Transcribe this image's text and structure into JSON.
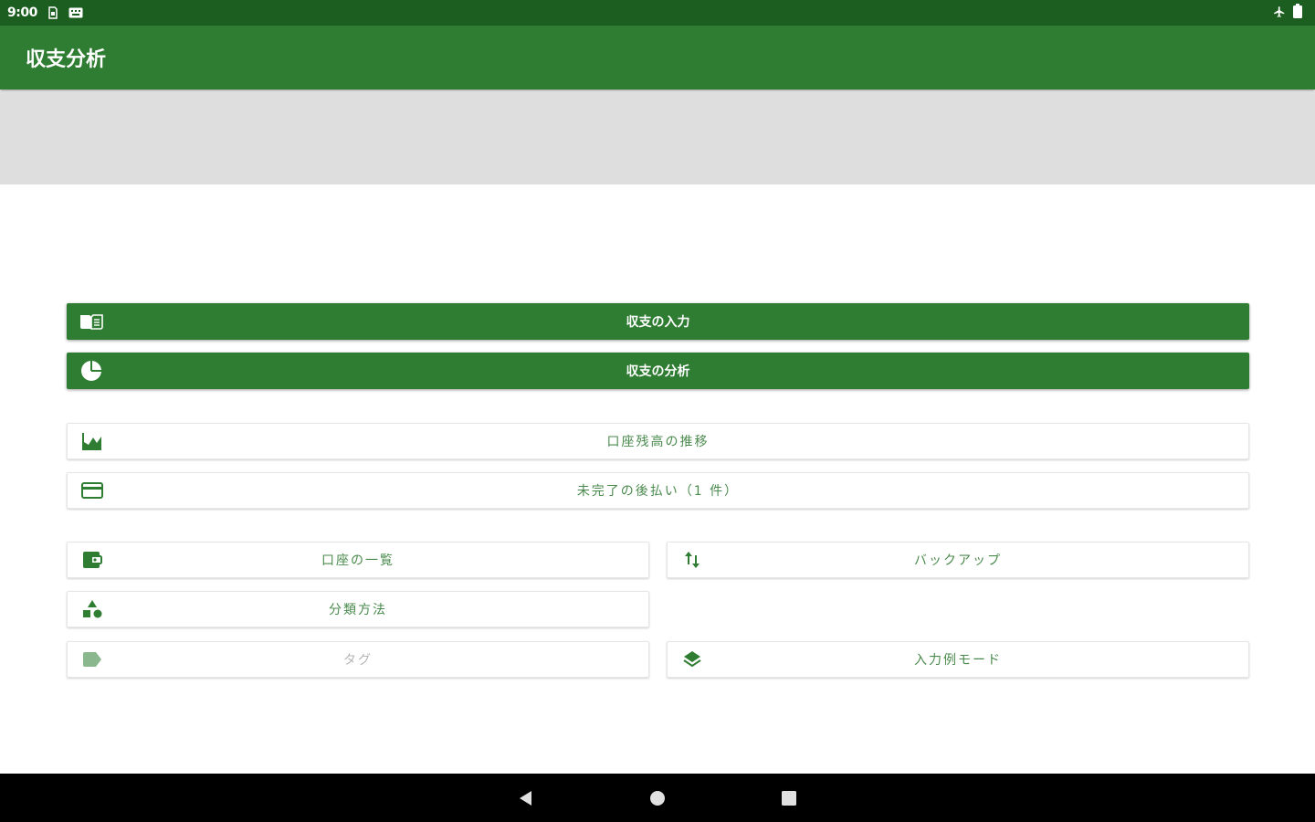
{
  "status_bar": {
    "time": "9:00",
    "left_icons": [
      "sim-icon",
      "keyboard-icon"
    ],
    "right_icons": [
      "airplane-icon",
      "battery-icon"
    ]
  },
  "app_bar": {
    "title": "収支分析"
  },
  "colors": {
    "primary": "#2e7d32",
    "primary_dark": "#1b5e20",
    "banner": "#dedede",
    "outline_text": "#4a8a4d",
    "disabled_text": "#b5b5b5"
  },
  "primary_buttons": [
    {
      "label": "収支の入力",
      "icon": "ledger-book-icon"
    },
    {
      "label": "収支の分析",
      "icon": "pie-chart-icon"
    }
  ],
  "outline_buttons_wide": [
    {
      "label": "口座残高の推移",
      "icon": "area-chart-icon"
    },
    {
      "label": "未完了の後払い（1 件）",
      "icon": "credit-card-icon"
    }
  ],
  "grid_buttons": {
    "account_list": {
      "label": "口座の一覧",
      "icon": "wallet-icon"
    },
    "backup": {
      "label": "バックアップ",
      "icon": "sort-arrows-icon"
    },
    "classification": {
      "label": "分類方法",
      "icon": "category-shapes-icon"
    },
    "tags": {
      "label": "タグ",
      "icon": "tag-icon"
    },
    "input_mode": {
      "label": "入力例モード",
      "icon": "layers-icon"
    }
  },
  "nav_bar": {
    "buttons": [
      "back-icon",
      "home-icon",
      "recents-icon"
    ]
  }
}
